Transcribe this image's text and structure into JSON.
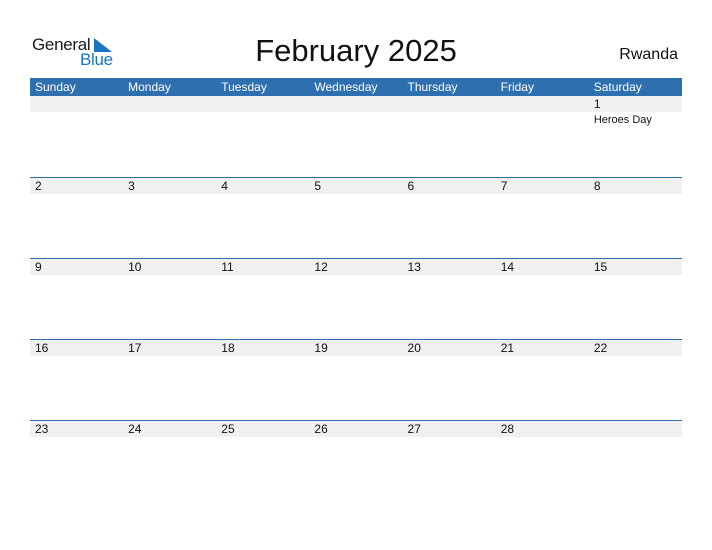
{
  "logo": {
    "word1": "General",
    "word2": "Blue",
    "accent": "#1a74c4"
  },
  "title": "February 2025",
  "country": "Rwanda",
  "colors": {
    "header_bg": "#2e6fb0",
    "strip_bg": "#f0f0f0"
  },
  "weekdays": [
    "Sunday",
    "Monday",
    "Tuesday",
    "Wednesday",
    "Thursday",
    "Friday",
    "Saturday"
  ],
  "weeks": [
    {
      "days": [
        {
          "num": ""
        },
        {
          "num": ""
        },
        {
          "num": ""
        },
        {
          "num": ""
        },
        {
          "num": ""
        },
        {
          "num": ""
        },
        {
          "num": "1",
          "holiday": "Heroes Day"
        }
      ]
    },
    {
      "days": [
        {
          "num": "2"
        },
        {
          "num": "3"
        },
        {
          "num": "4"
        },
        {
          "num": "5"
        },
        {
          "num": "6"
        },
        {
          "num": "7"
        },
        {
          "num": "8"
        }
      ]
    },
    {
      "days": [
        {
          "num": "9"
        },
        {
          "num": "10"
        },
        {
          "num": "11"
        },
        {
          "num": "12"
        },
        {
          "num": "13"
        },
        {
          "num": "14"
        },
        {
          "num": "15"
        }
      ]
    },
    {
      "days": [
        {
          "num": "16"
        },
        {
          "num": "17"
        },
        {
          "num": "18"
        },
        {
          "num": "19"
        },
        {
          "num": "20"
        },
        {
          "num": "21"
        },
        {
          "num": "22"
        }
      ]
    },
    {
      "days": [
        {
          "num": "23"
        },
        {
          "num": "24"
        },
        {
          "num": "25"
        },
        {
          "num": "26"
        },
        {
          "num": "27"
        },
        {
          "num": "28"
        },
        {
          "num": ""
        }
      ]
    }
  ]
}
